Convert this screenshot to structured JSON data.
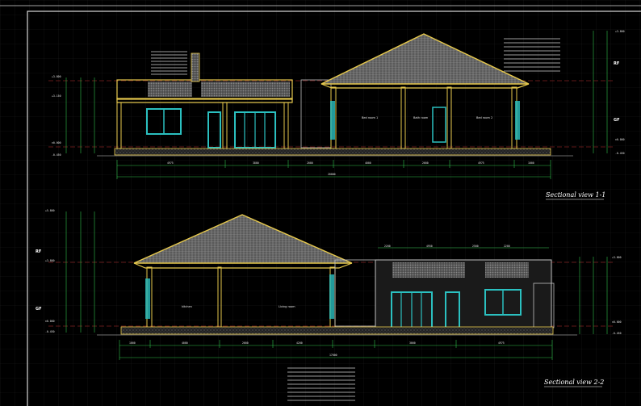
{
  "section_1": {
    "title": "Sectional view 1-1",
    "rooms": [
      "Bed room 1",
      "Bath room",
      "Bed room 2"
    ],
    "overall_dimension": "20000",
    "segment_dimensions": [
      "4975",
      "3800",
      "2000",
      "4000",
      "2600",
      "4975",
      "1000"
    ],
    "level_left": [
      "+3.800",
      "+3.150",
      "±0.000",
      "-0.450"
    ],
    "level_right": [
      "+3.800",
      "±0.000",
      "-0.450"
    ],
    "marker_rf": "RF",
    "marker_gf": "GF"
  },
  "section_2": {
    "title": "Sectional view 2-2",
    "rooms": [
      "kitchen",
      "Living room"
    ],
    "overall_dimension": "17000",
    "segment_dimensions": [
      "1000",
      "4000",
      "2600",
      "4200",
      "3000",
      "4975"
    ],
    "top_dimensions": [
      "2200",
      "4950",
      "2500",
      "2200"
    ],
    "level_left": [
      "+5.800",
      "+3.800",
      "±0.000",
      "-0.450"
    ],
    "level_right": [
      "+3.800",
      "±0.000",
      "-0.450"
    ],
    "marker_rf": "RF",
    "marker_gf": "GF"
  },
  "colors": {
    "background": "#000000",
    "wall": "#e6c84c",
    "roof": "#8c8c8c",
    "window": "#2bc0c0",
    "dimension": "#2fbf4a",
    "level_line": "#c03030",
    "grid": "#1c1c1c"
  }
}
